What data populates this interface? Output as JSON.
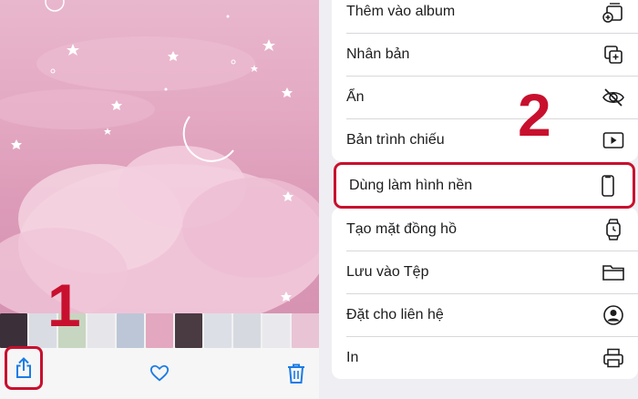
{
  "photo_viewer": {
    "toolbar": {
      "share_icon": "share-icon",
      "favorite_icon": "heart-icon",
      "delete_icon": "trash-icon"
    },
    "accent_color": "#1a7be6"
  },
  "annotations": {
    "step1": "1",
    "step2": "2",
    "color": "#c8102e"
  },
  "share_sheet": {
    "group1": [
      {
        "label": "Thêm vào album",
        "icon": "add-album-icon"
      },
      {
        "label": "Nhân bản",
        "icon": "duplicate-icon"
      },
      {
        "label": "Ẩn",
        "icon": "eye-slash-icon"
      },
      {
        "label": "Bản trình chiếu",
        "icon": "slideshow-icon"
      }
    ],
    "highlighted": {
      "label": "Dùng làm hình nền",
      "icon": "phone-icon"
    },
    "group2": [
      {
        "label": "Tạo mặt đồng hồ",
        "icon": "watch-icon"
      },
      {
        "label": "Lưu vào Tệp",
        "icon": "folder-icon"
      },
      {
        "label": "Đặt cho liên hệ",
        "icon": "contact-icon"
      },
      {
        "label": "In",
        "icon": "printer-icon"
      }
    ]
  }
}
